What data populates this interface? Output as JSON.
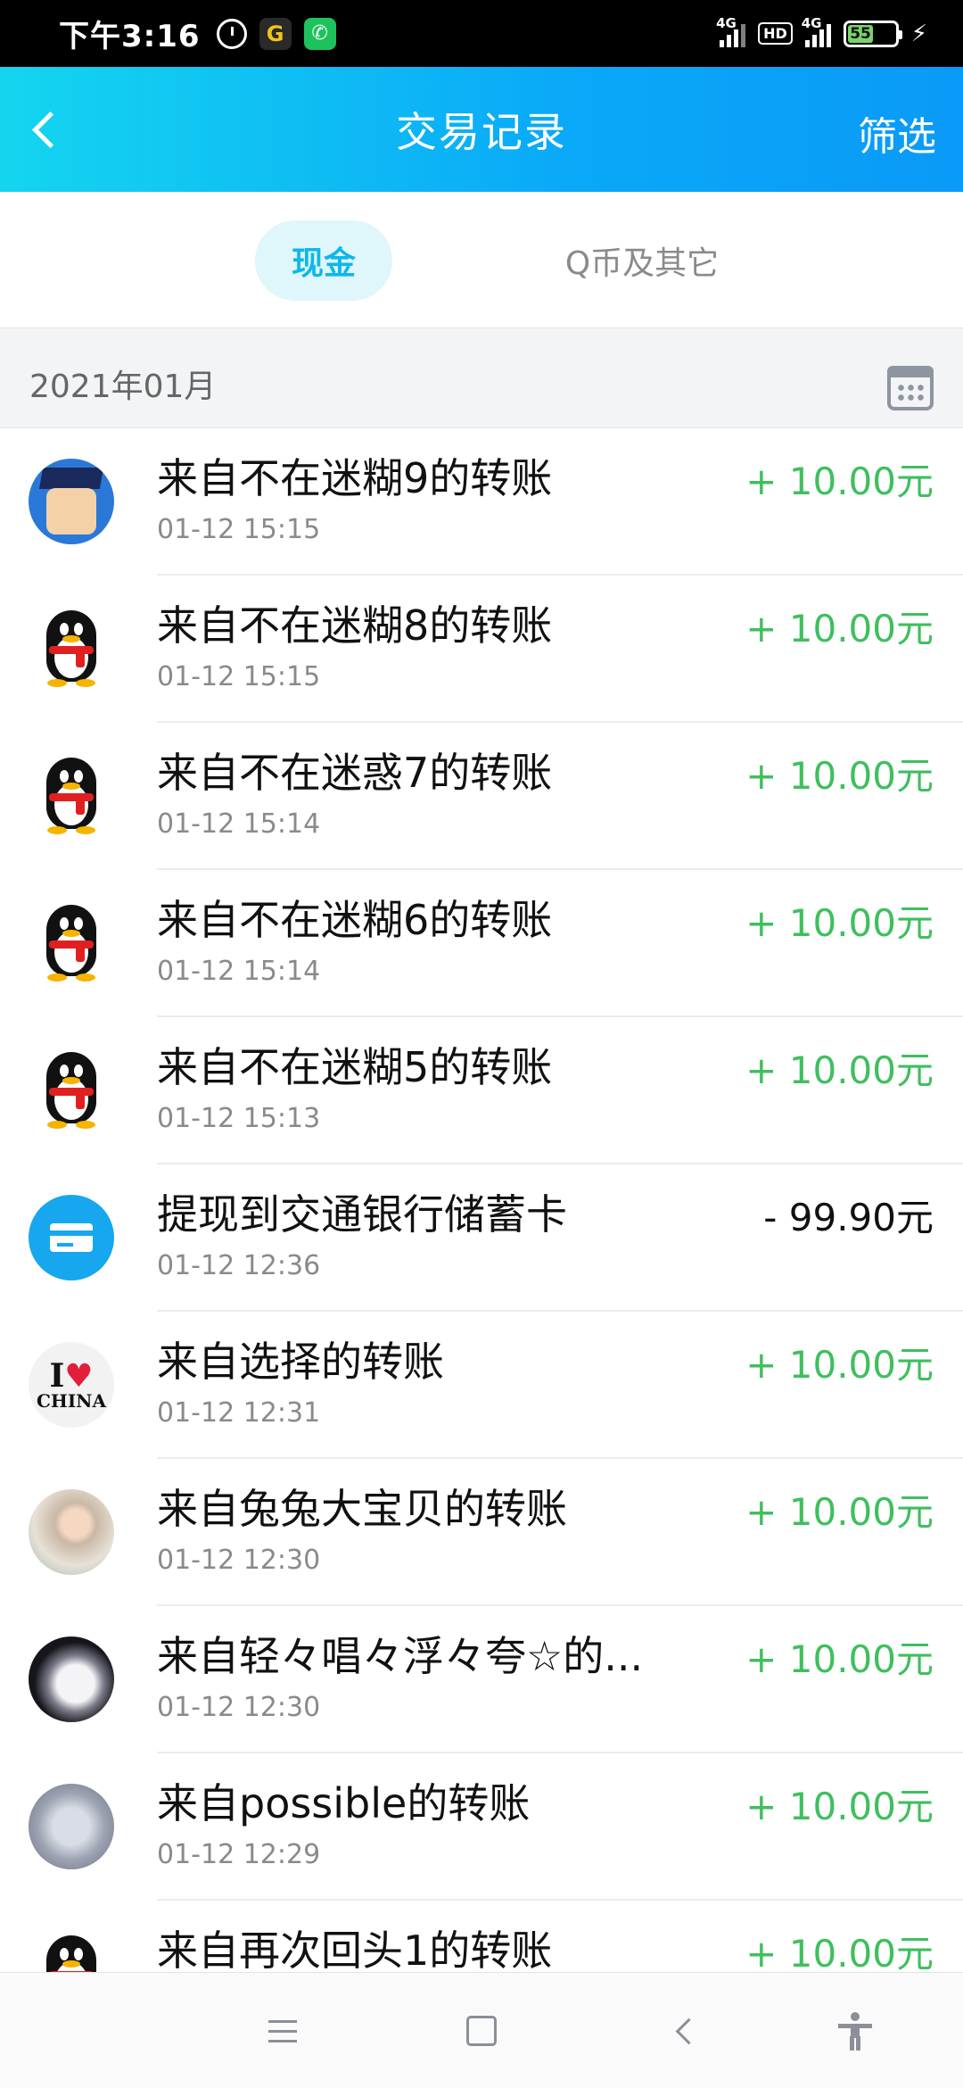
{
  "status_bar": {
    "time": "下午3:16",
    "network1": "4G",
    "hd": "HD",
    "network2": "4G",
    "battery": "55",
    "icons": [
      "alarm-icon",
      "app-icon",
      "phone-icon",
      "signal-icon",
      "hd-icon",
      "signal-icon",
      "battery-icon",
      "charging-icon"
    ]
  },
  "header": {
    "back_icon": "chevron-left-icon",
    "title": "交易记录",
    "filter_label": "筛选"
  },
  "tabs": [
    {
      "label": "现金",
      "active": true
    },
    {
      "label": "Q币及其它",
      "active": false
    }
  ],
  "month": {
    "label": "2021年01月",
    "icon": "calendar-icon"
  },
  "transactions": [
    {
      "title": "来自不在迷糊9的转账",
      "time": "01-12 15:15",
      "amount": "+ 10.00元",
      "avatar": "cartoon-graduate"
    },
    {
      "title": "来自不在迷糊8的转账",
      "time": "01-12 15:15",
      "amount": "+ 10.00元",
      "avatar": "qq-penguin"
    },
    {
      "title": "来自不在迷惑7的转账",
      "time": "01-12 15:14",
      "amount": "+ 10.00元",
      "avatar": "qq-penguin"
    },
    {
      "title": "来自不在迷糊6的转账",
      "time": "01-12 15:14",
      "amount": "+ 10.00元",
      "avatar": "qq-penguin"
    },
    {
      "title": "来自不在迷糊5的转账",
      "time": "01-12 15:13",
      "amount": "+ 10.00元",
      "avatar": "qq-penguin"
    },
    {
      "title": "提现到交通银行储蓄卡",
      "time": "01-12 12:36",
      "amount": "- 99.90元",
      "avatar": "bank-card"
    },
    {
      "title": "来自选择的转账",
      "time": "01-12 12:31",
      "amount": "+ 10.00元",
      "avatar": "i-love-china"
    },
    {
      "title": "来自兔兔大宝贝的转账",
      "time": "01-12 12:30",
      "amount": "+ 10.00元",
      "avatar": "photo"
    },
    {
      "title": "来自轻々唱々浮々夸☆的...",
      "time": "01-12 12:30",
      "amount": "+ 10.00元",
      "avatar": "photo"
    },
    {
      "title": "来自possible的转账",
      "time": "01-12 12:29",
      "amount": "+ 10.00元",
      "avatar": "photo"
    },
    {
      "title": "来自再次回头1的转账",
      "time": "",
      "amount": "+ 10.00元",
      "avatar": "qq-penguin"
    }
  ],
  "avatar_text": {
    "love_line1_a": "I",
    "love_heart": "♥",
    "love_line2": "CHINA"
  },
  "colors": {
    "header_gradient_start": "#14d5ef",
    "header_gradient_end": "#0a9af7",
    "active_tab_text": "#0fb7ea",
    "positive_amount": "#3fbf5e",
    "negative_amount": "#111111"
  },
  "nav_bar": {
    "icons": [
      "menu-icon",
      "home-icon",
      "back-icon",
      "accessibility-icon"
    ]
  }
}
